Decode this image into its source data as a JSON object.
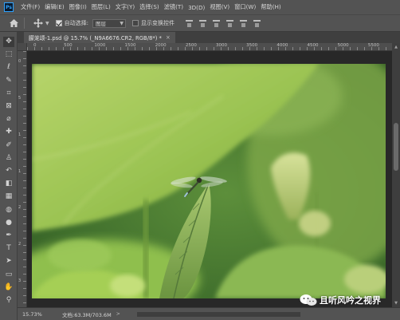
{
  "app": {
    "logo_text": "Ps"
  },
  "menu": {
    "items": [
      "文件(F)",
      "编辑(E)",
      "图像(I)",
      "图层(L)",
      "文字(Y)",
      "选择(S)",
      "滤镜(T)",
      "3D(D)",
      "视图(V)",
      "窗口(W)",
      "帮助(H)"
    ]
  },
  "options": {
    "auto_select_label": "自动选择:",
    "auto_select_checked": true,
    "target_value": "图层",
    "show_transform_label": "显示变换控件",
    "show_transform_checked": false
  },
  "document": {
    "tab_title": "朦茏颂-1.psd @ 15.7% (_N9A6676.CR2, RGB/8*) *",
    "close_label": "×"
  },
  "ruler": {
    "top_labels": [
      "0",
      "500",
      "1000",
      "1500",
      "2000",
      "2500",
      "3000",
      "3500",
      "4000",
      "4500",
      "5000",
      "5500"
    ],
    "left_labels": [
      "0",
      "5",
      "1",
      "1",
      "2",
      "2",
      "3"
    ]
  },
  "status": {
    "zoom": "15.73%",
    "doc_info": "文档:63.3M/703.6M",
    "arrow": ">"
  },
  "watermark": {
    "text": "且听风吟之视界"
  },
  "tools": [
    {
      "name": "move-tool-icon",
      "glyph": "✥"
    },
    {
      "name": "marquee-tool-icon",
      "glyph": "⬚"
    },
    {
      "name": "lasso-tool-icon",
      "glyph": "ℓ"
    },
    {
      "name": "quick-select-tool-icon",
      "glyph": "✎"
    },
    {
      "name": "crop-tool-icon",
      "glyph": "⌗"
    },
    {
      "name": "frame-tool-icon",
      "glyph": "⊠"
    },
    {
      "name": "eyedropper-tool-icon",
      "glyph": "⌀"
    },
    {
      "name": "healing-brush-tool-icon",
      "glyph": "✚"
    },
    {
      "name": "brush-tool-icon",
      "glyph": "✐"
    },
    {
      "name": "clone-stamp-tool-icon",
      "glyph": "♙"
    },
    {
      "name": "history-brush-tool-icon",
      "glyph": "↶"
    },
    {
      "name": "eraser-tool-icon",
      "glyph": "◧"
    },
    {
      "name": "gradient-tool-icon",
      "glyph": "▦"
    },
    {
      "name": "blur-tool-icon",
      "glyph": "◍"
    },
    {
      "name": "dodge-tool-icon",
      "glyph": "●"
    },
    {
      "name": "pen-tool-icon",
      "glyph": "✒"
    },
    {
      "name": "type-tool-icon",
      "glyph": "T"
    },
    {
      "name": "path-select-tool-icon",
      "glyph": "➤"
    },
    {
      "name": "rectangle-tool-icon",
      "glyph": "▭"
    },
    {
      "name": "hand-tool-icon",
      "glyph": "✋"
    },
    {
      "name": "zoom-tool-icon",
      "glyph": "⚲"
    }
  ]
}
